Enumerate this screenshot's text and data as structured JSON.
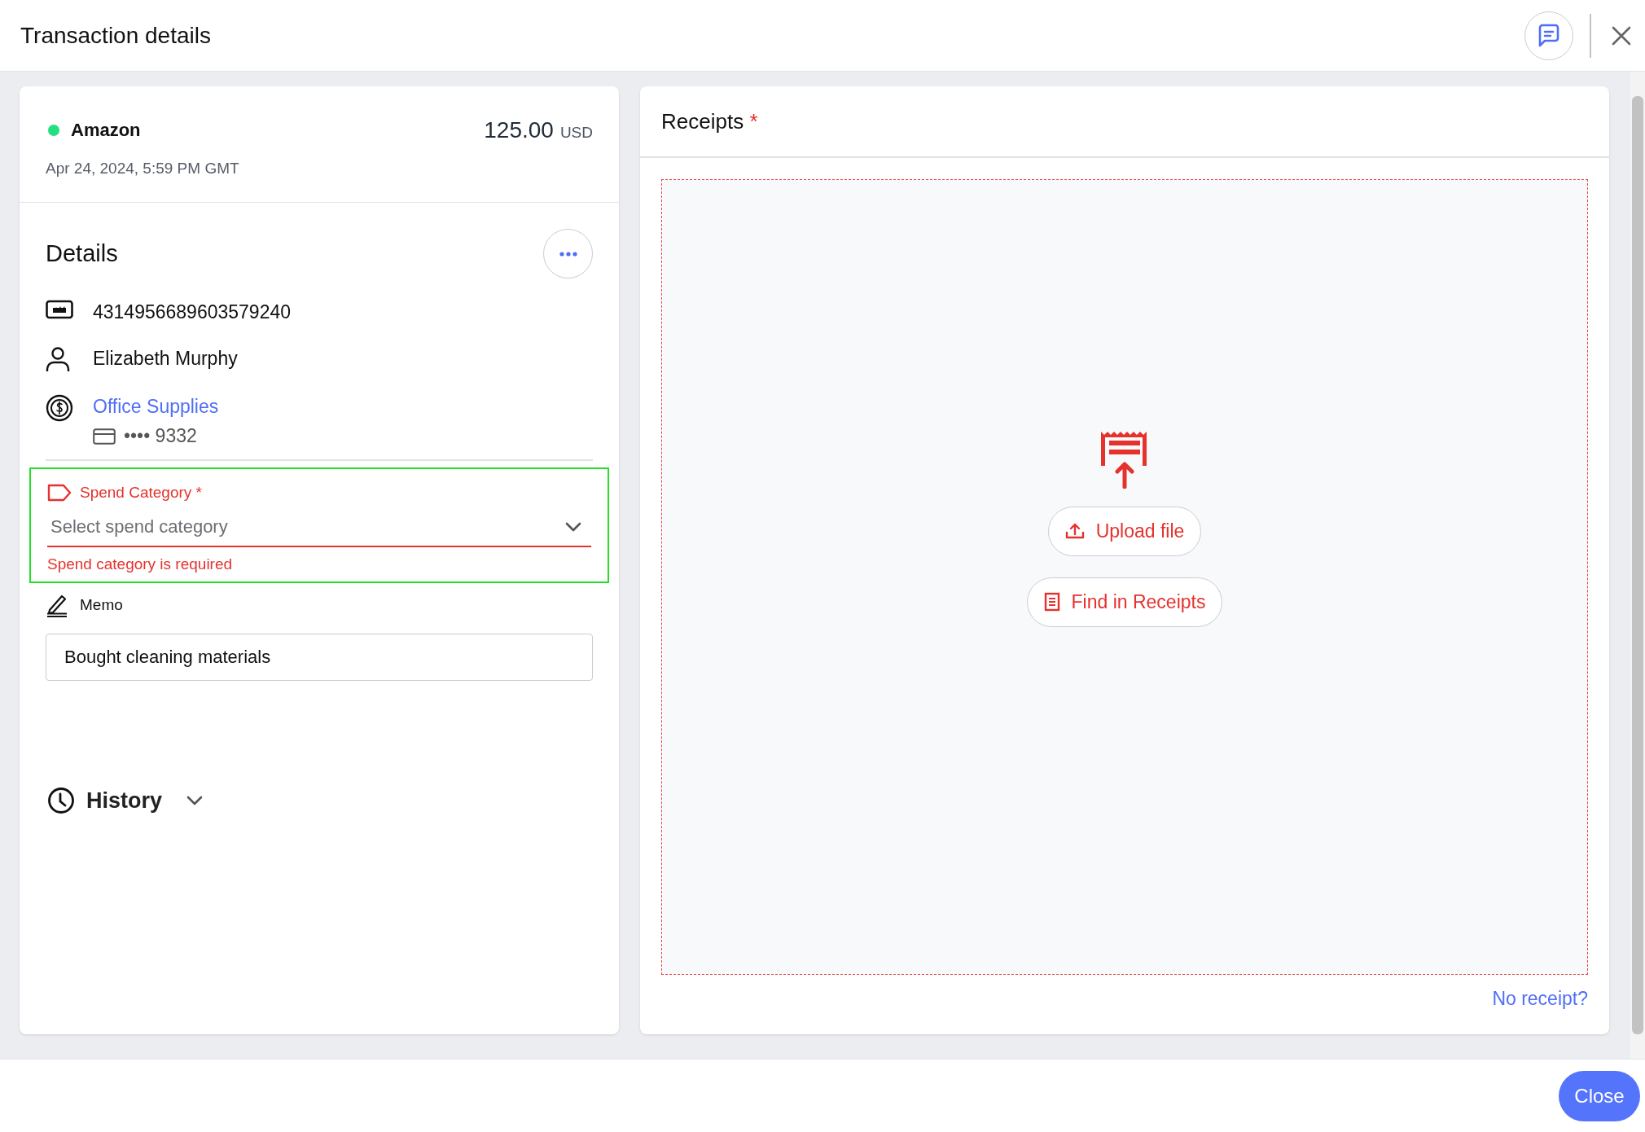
{
  "header": {
    "title": "Transaction details"
  },
  "summary": {
    "merchant": "Amazon",
    "amount": "125.00",
    "currency": "USD",
    "date": "Apr 24, 2024, 5:59 PM GMT"
  },
  "details": {
    "title": "Details",
    "rows": [
      {
        "kind": "card_number",
        "text": "4314956689603579240"
      },
      {
        "kind": "person",
        "text": "Elizabeth Murphy"
      },
      {
        "kind": "account",
        "text": "Office Supplies",
        "sub": "•••• 9332"
      }
    ]
  },
  "spend_category": {
    "label": "Spend Category",
    "required_mark": "*",
    "placeholder": "Select spend category",
    "error": "Spend category is required",
    "highlighted": true
  },
  "memo": {
    "label": "Memo",
    "value": "Bought cleaning materials"
  },
  "history": {
    "label": "History",
    "expanded": false
  },
  "receipts": {
    "title": "Receipts",
    "required_mark": "*",
    "buttons": [
      {
        "kind": "upload",
        "label": "Upload file"
      },
      {
        "kind": "find",
        "label": "Find in Receipts"
      }
    ],
    "no_receipt_link": "No receipt?"
  },
  "footer": {
    "close_button": "Close"
  }
}
